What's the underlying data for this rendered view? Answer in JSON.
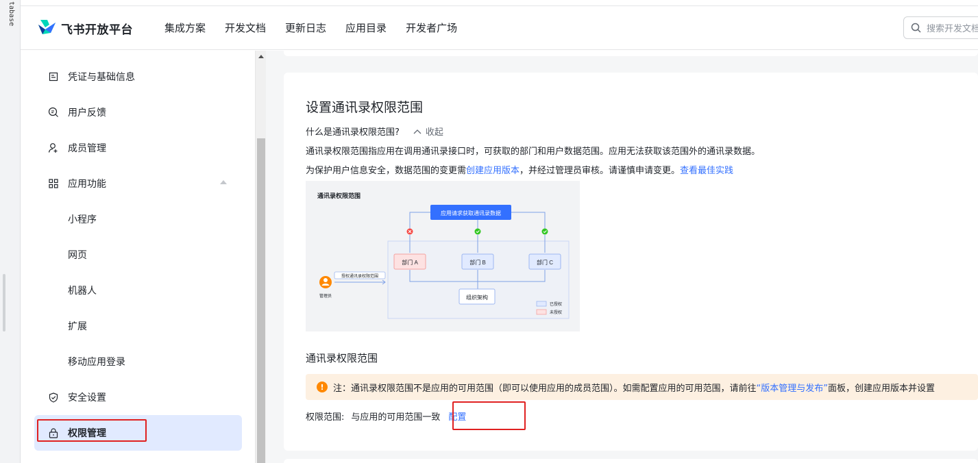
{
  "left_strip": {
    "text": "tabase"
  },
  "header": {
    "brand": "飞书开放平台",
    "nav": [
      "集成方案",
      "开发文档",
      "更新日志",
      "应用目录",
      "开发者广场"
    ],
    "search_placeholder": "搜索开发文档"
  },
  "sidebar": {
    "items": [
      {
        "label": "凭证与基础信息",
        "icon": "credential-icon"
      },
      {
        "label": "用户反馈",
        "icon": "feedback-icon"
      },
      {
        "label": "成员管理",
        "icon": "member-icon"
      },
      {
        "label": "应用功能",
        "icon": "grid-icon"
      },
      {
        "label": "小程序"
      },
      {
        "label": "网页"
      },
      {
        "label": "机器人"
      },
      {
        "label": "扩展"
      },
      {
        "label": "移动应用登录"
      },
      {
        "label": "安全设置",
        "icon": "shield-icon"
      },
      {
        "label": "权限管理",
        "icon": "lock-icon",
        "active": true
      }
    ]
  },
  "main": {
    "title": "设置通讯录权限范围",
    "question": "什么是通讯录权限范围?",
    "collapse_label": "收起",
    "desc1": "通讯录权限范围指应用在调用通讯录接口时，可获取的部门和用户数据范围。应用无法获取该范围外的通讯录数据。",
    "desc2_prefix": "为保护用户信息安全，数据范围的变更需",
    "desc2_link1": "创建应用版本",
    "desc2_middle": "，并经过管理员审核。请谨慎申请变更。",
    "desc2_link2": "查看最佳实践",
    "diagram": {
      "title": "通讯录权限范围",
      "request_box": "应用请求获取通讯录数据",
      "dept_a": "部门 A",
      "dept_b": "部门 B",
      "dept_c": "部门 C",
      "org": "组织架构",
      "auth_label": "授权通讯录权限范围",
      "admin": "管理员",
      "legend_authorized": "已授权",
      "legend_unauthorized": "未授权"
    },
    "section_title": "通讯录权限范围",
    "notice_icon": "!",
    "notice_prefix": "注：通讯录权限范围不是应用的可用范围（即可以使用应用的成员范围）。如需配置应用的可用范围，请前往",
    "notice_link": "“版本管理与发布”",
    "notice_suffix": "面板，创建应用版本并设置",
    "scope_label": "权限范围:",
    "scope_value": "与应用的可用范围一致",
    "config_link": "配置"
  },
  "colors": {
    "accent": "#3370ff",
    "active_bg": "#e1eaff",
    "notice_bg": "#fdf0e1",
    "warn": "#ff8800",
    "highlight_box": "#e02020"
  }
}
